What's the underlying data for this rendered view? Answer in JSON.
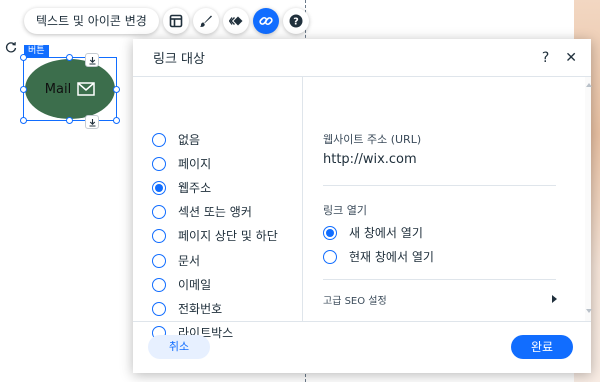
{
  "toolbar": {
    "edit_text_label": "텍스트 및 아이콘 변경",
    "icons": [
      "layout-icon",
      "brush-icon",
      "animation-icon",
      "link-icon",
      "help-icon"
    ]
  },
  "element": {
    "badge": "버튼",
    "button_label": "Mail",
    "button_color": "#3c6e4c",
    "icon": "envelope-icon"
  },
  "panel": {
    "title": "링크 대상",
    "help": "?",
    "close": "✕",
    "link_types": [
      {
        "label": "없음",
        "selected": false
      },
      {
        "label": "페이지",
        "selected": false
      },
      {
        "label": "웹주소",
        "selected": true
      },
      {
        "label": "섹션 또는 앵커",
        "selected": false
      },
      {
        "label": "페이지 상단 및 하단",
        "selected": false
      },
      {
        "label": "문서",
        "selected": false
      },
      {
        "label": "이메일",
        "selected": false
      },
      {
        "label": "전화번호",
        "selected": false
      },
      {
        "label": "라이트박스",
        "selected": false
      }
    ],
    "url_label": "웹사이트 주소 (URL)",
    "url_value": "http://wix.com",
    "open_label": "링크 열기",
    "open_options": [
      {
        "label": "새 창에서 열기",
        "selected": true
      },
      {
        "label": "현재 창에서 열기",
        "selected": false
      }
    ],
    "seo_label": "고급 SEO 설정",
    "cancel": "취소",
    "done": "완료"
  },
  "colors": {
    "accent": "#116dff",
    "text": "#20303c"
  }
}
